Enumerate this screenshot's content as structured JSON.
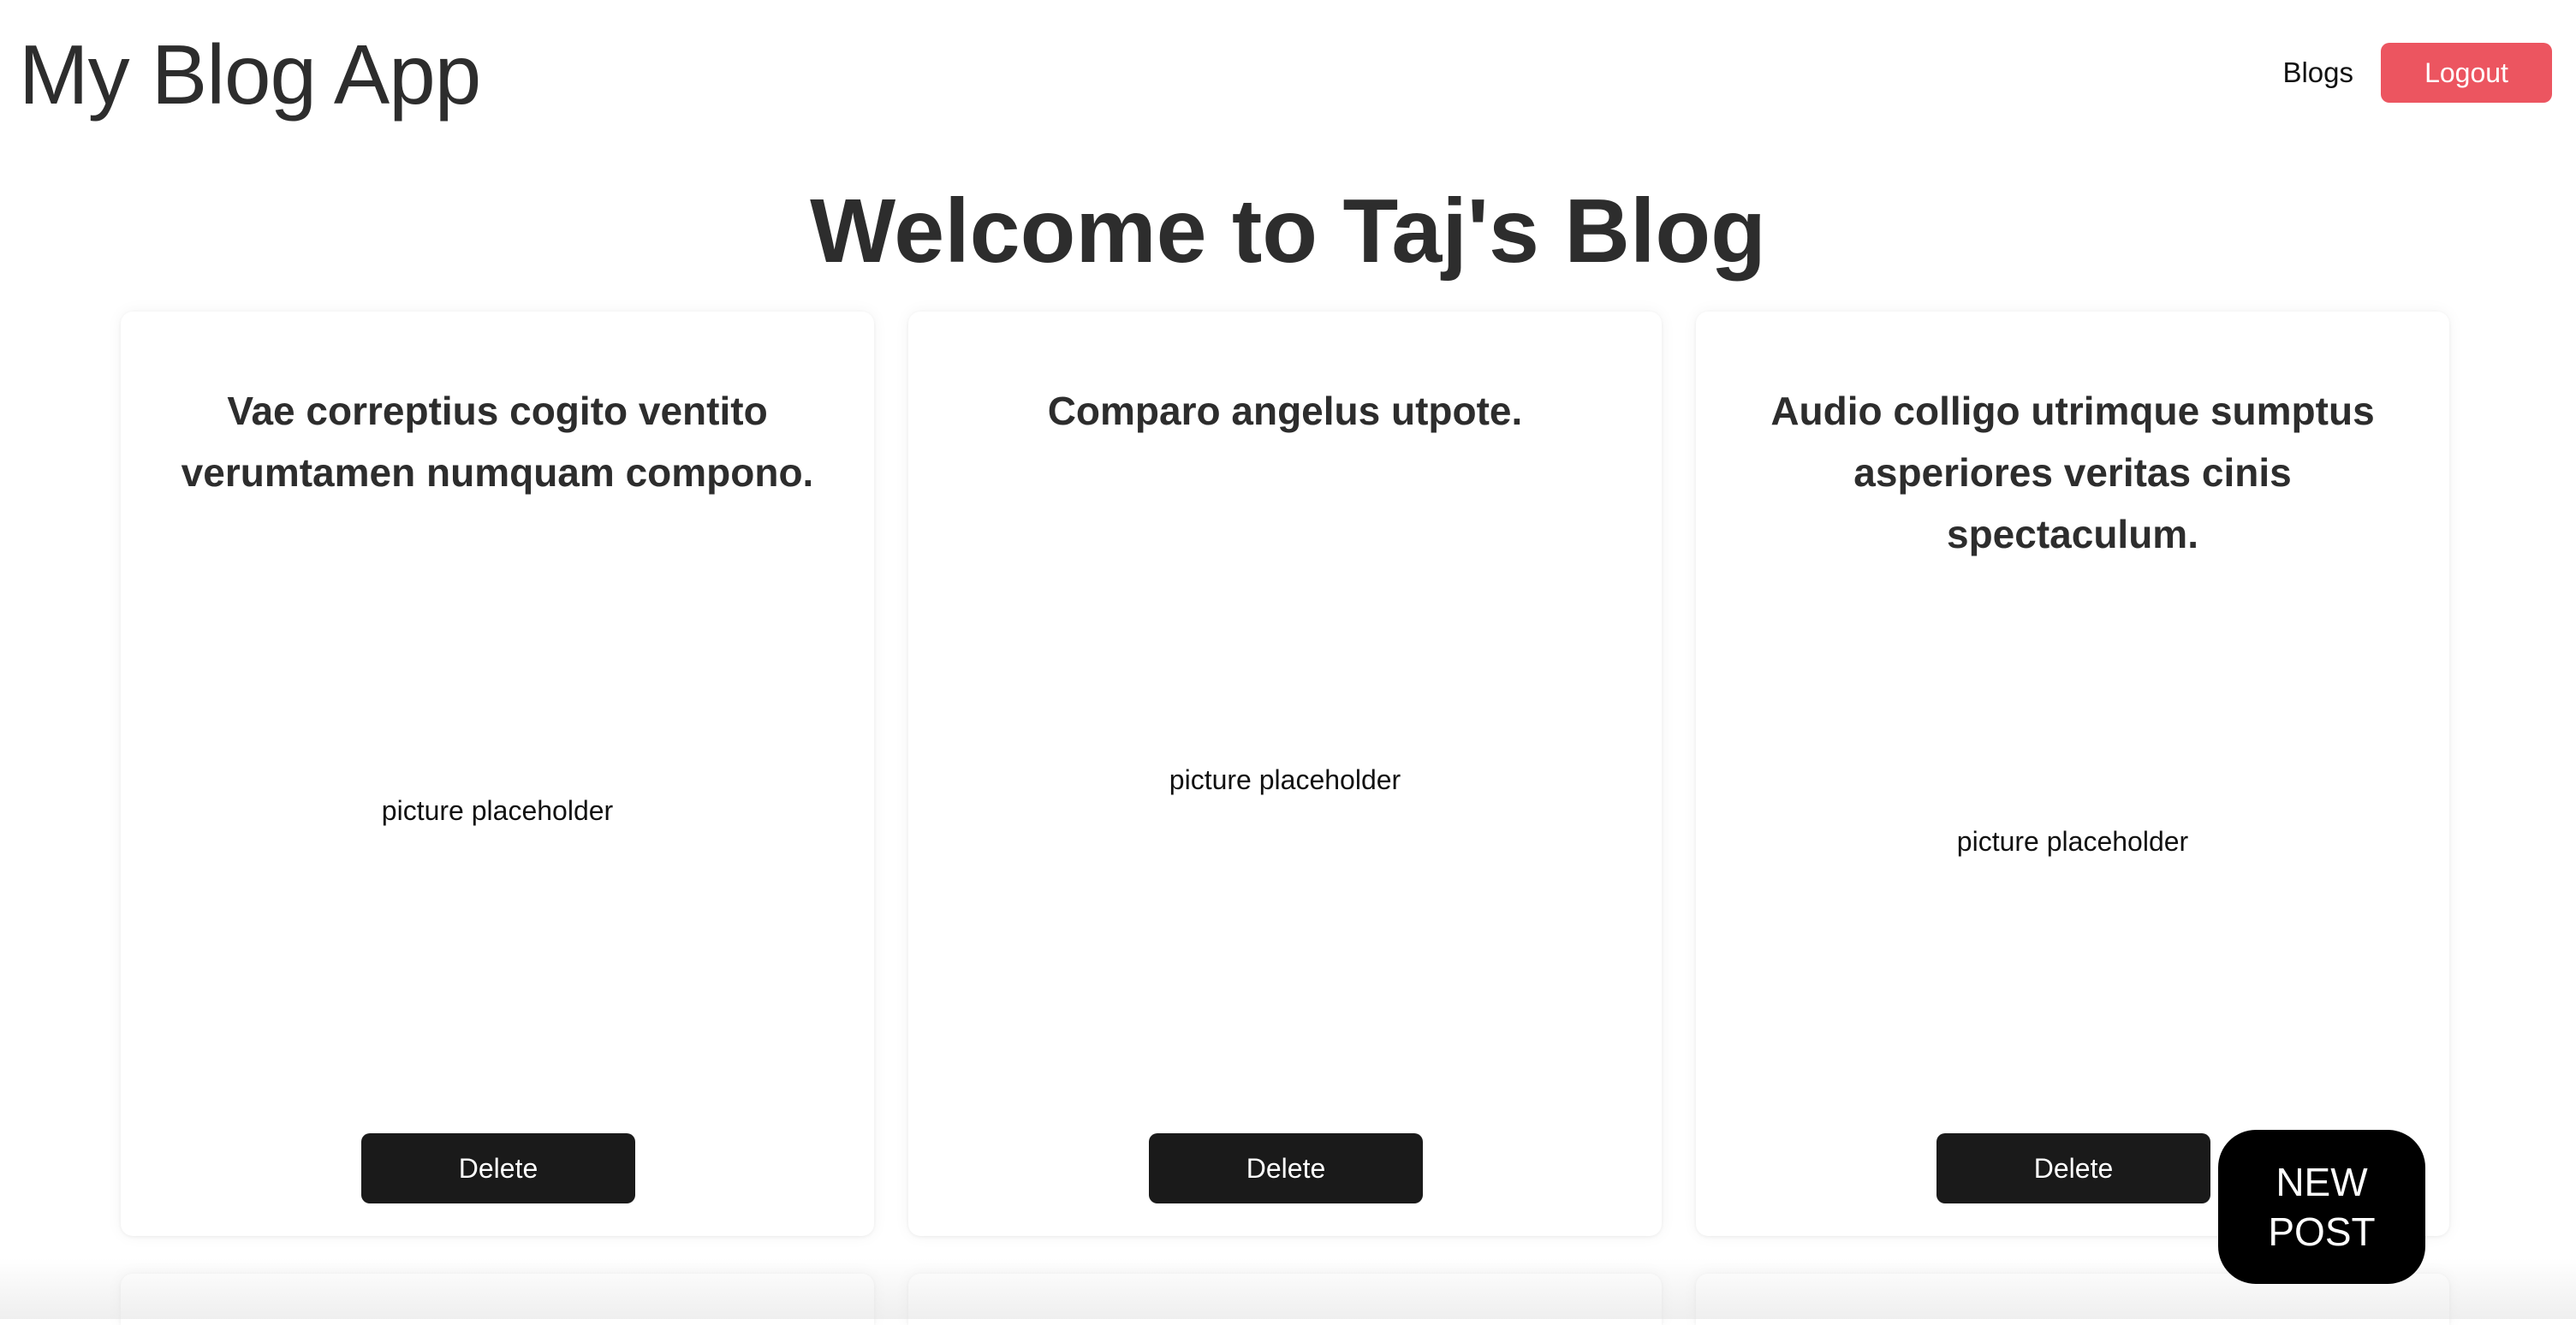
{
  "header": {
    "app_title": "My Blog App",
    "nav_blogs": "Blogs",
    "logout_label": "Logout"
  },
  "main": {
    "page_title": "Welcome to Taj's Blog",
    "posts": [
      {
        "title": "Vae correptius cogito ventito verumtamen numquam compono.",
        "picture": "picture placeholder",
        "delete_label": "Delete"
      },
      {
        "title": "Comparo angelus utpote.",
        "picture": "picture placeholder",
        "delete_label": "Delete"
      },
      {
        "title": "Audio colligo utrimque sumptus asperiores veritas cinis spectaculum.",
        "picture": "picture placeholder",
        "delete_label": "Delete"
      }
    ],
    "new_post_label": "NEW POST"
  },
  "colors": {
    "logout_bg": "#ec5560",
    "delete_bg": "#1a1a1a",
    "new_post_bg": "#000000",
    "text": "#2d2d2d"
  }
}
